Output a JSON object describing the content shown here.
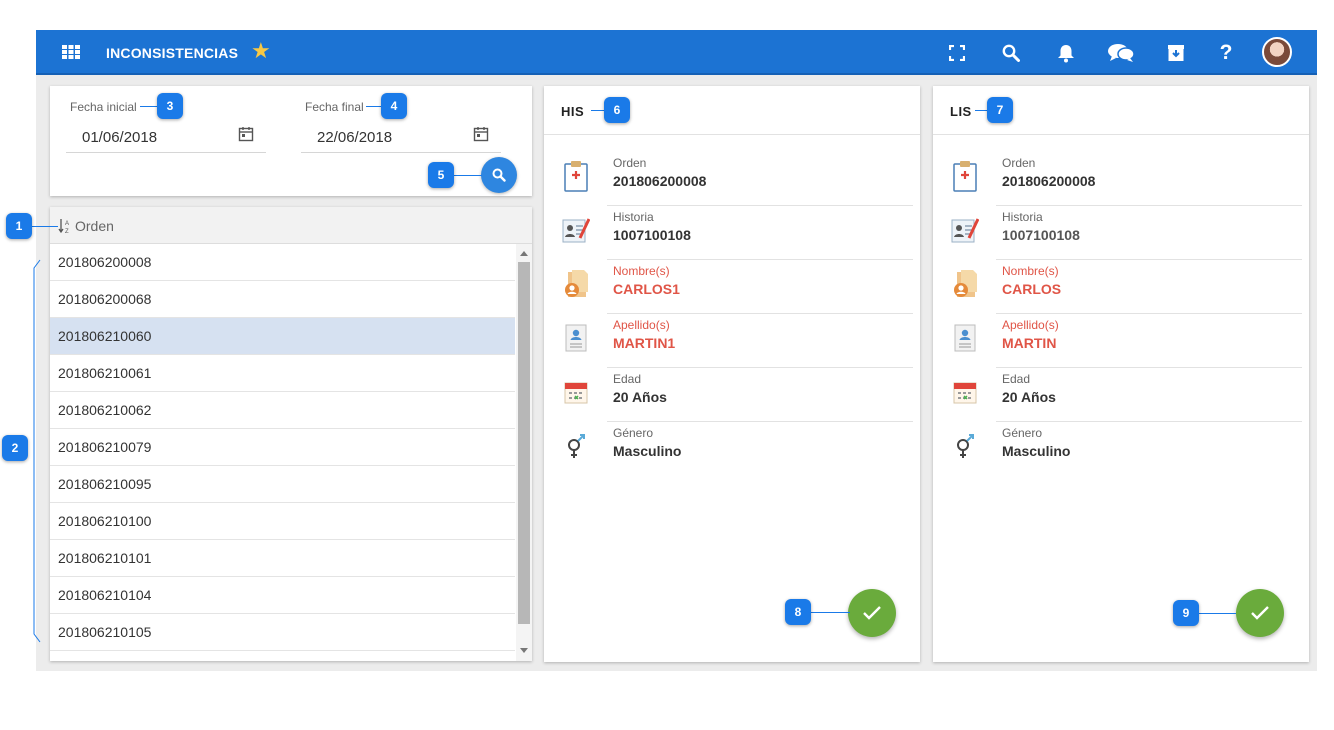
{
  "header": {
    "title": "INCONSISTENCIAS"
  },
  "filters": {
    "start_label": "Fecha inicial",
    "start_value": "01/06/2018",
    "end_label": "Fecha final",
    "end_value": "22/06/2018"
  },
  "list": {
    "header_label": "Orden",
    "sort_glyph": "↓A Z",
    "rows": [
      "201806200008",
      "201806200068",
      "201806210060",
      "201806210061",
      "201806210062",
      "201806210079",
      "201806210095",
      "201806210100",
      "201806210101",
      "201806210104",
      "201806210105"
    ],
    "selected_index": 2
  },
  "his": {
    "title": "HIS",
    "fields": [
      {
        "label": "Orden",
        "value": "201806200008"
      },
      {
        "label": "Historia",
        "value": "1007100108"
      },
      {
        "label": "Nombre(s)",
        "value": "CARLOS1"
      },
      {
        "label": "Apellido(s)",
        "value": "MARTIN1"
      },
      {
        "label": "Edad",
        "value": "20 Años"
      },
      {
        "label": "Género",
        "value": "Masculino"
      }
    ]
  },
  "lis": {
    "title": "LIS",
    "fields": [
      {
        "label": "Orden",
        "value": "201806200008"
      },
      {
        "label": "Historia",
        "value": "1007100108"
      },
      {
        "label": "Nombre(s)",
        "value": "CARLOS"
      },
      {
        "label": "Apellido(s)",
        "value": "MARTIN"
      },
      {
        "label": "Edad",
        "value": "20 Años"
      },
      {
        "label": "Género",
        "value": "Masculino"
      }
    ]
  },
  "callouts": [
    "1",
    "2",
    "3",
    "4",
    "5",
    "6",
    "7",
    "8",
    "9"
  ],
  "colors": {
    "primary": "#1c73d3",
    "accent_green": "#6aab3c",
    "mismatch_red": "#e05547",
    "callout_blue": "#1a7ae8",
    "selected_row": "#d6e1f1"
  },
  "icons": {
    "topbar": [
      "apps-grid-icon",
      "star-icon",
      "fullscreen-icon",
      "search-icon",
      "bell-icon",
      "chat-icon",
      "archive-icon",
      "help-icon",
      "avatar"
    ],
    "fields": [
      "clipboard-icon",
      "record-icon",
      "person-folder-icon",
      "id-card-icon",
      "calendar-icon",
      "gender-icon"
    ]
  }
}
